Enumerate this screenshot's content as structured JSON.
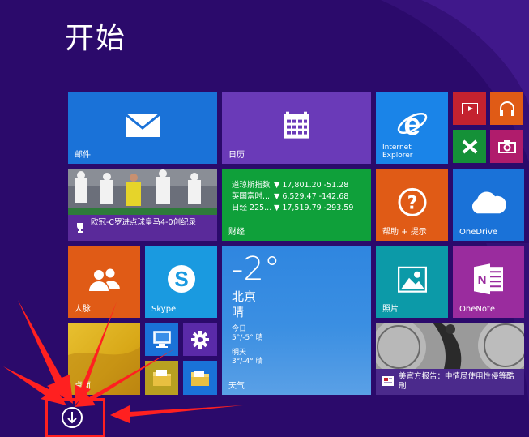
{
  "screen": {
    "title": "开始",
    "background": "#2b0a6b"
  },
  "tiles": {
    "mail": {
      "label": "邮件",
      "color": "#1a72d8"
    },
    "calendar": {
      "label": "日历",
      "color": "#6a3ab8"
    },
    "ie": {
      "label1": "Internet",
      "label2": "Explorer",
      "color": "#1a84e8"
    },
    "video": {
      "color": "#c4222f"
    },
    "music": {
      "color": "#e05b16"
    },
    "games": {
      "color": "#159138"
    },
    "camera": {
      "color": "#b01c6c"
    },
    "sports": {
      "caption": "欧冠-C罗进点球皇马4-0创纪录",
      "color": "#5a2a9a"
    },
    "finance": {
      "label": "财经",
      "color": "#0fa03a",
      "rows": [
        {
          "name": "道琼斯指数",
          "value": "▼ 17,801.20 -51.28"
        },
        {
          "name": "英国富时...",
          "value": "▼ 6,529.47 -142.68"
        },
        {
          "name": "日经 225...",
          "value": "▼ 17,519.79 -293.59"
        }
      ]
    },
    "help": {
      "label": "帮助 + 提示",
      "color": "#e05b16"
    },
    "onedrive": {
      "label": "OneDrive",
      "color": "#1a72d8"
    },
    "people": {
      "label": "人脉",
      "color": "#e05b16"
    },
    "skype": {
      "label": "Skype",
      "color": "#1a9ae0"
    },
    "weather": {
      "temp": "-2°",
      "city": "北京",
      "condition": "晴",
      "today_label": "今日",
      "today_forecast": "5°/-5° 晴",
      "tomorrow_label": "明天",
      "tomorrow_forecast": "3°/-4° 晴",
      "label": "天气",
      "color": "#2a7ad8"
    },
    "photos": {
      "label": "照片",
      "color": "#0c9aa8"
    },
    "onenote": {
      "label": "OneNote",
      "color": "#9a2c9e"
    },
    "desktop": {
      "label": "桌面",
      "color": "#d8b020"
    },
    "computer": {
      "color": "#1a72d8"
    },
    "settings": {
      "color": "#5a2aa8"
    },
    "explorer": {
      "color": "#b8a020"
    },
    "docs": {
      "color": "#1a72d8"
    },
    "news": {
      "caption": "美官方报告：中情局使用性侵等酷刑",
      "color": "#4b2a8c"
    }
  },
  "apps_button": {
    "icon": "down-arrow-circle-icon",
    "highlight_color": "#ff2020"
  }
}
